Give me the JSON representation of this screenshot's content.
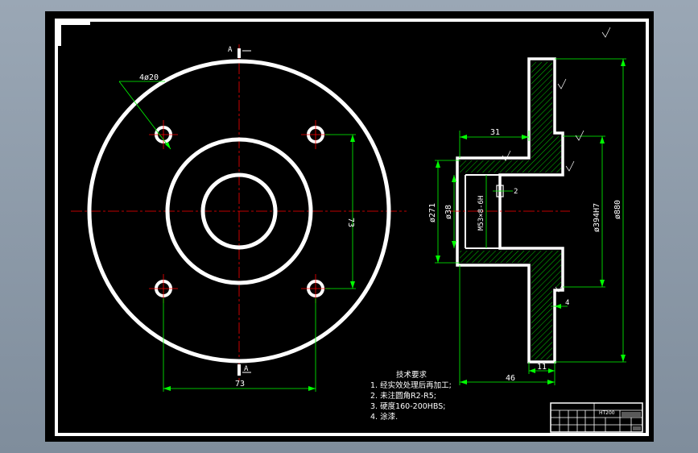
{
  "colors": {
    "viewport_bg": "#8d9aa8",
    "sheet_bg": "#000000",
    "outline": "#ffffff",
    "dimension": "#00ff00",
    "centerline": "#ff0000",
    "hatch": "#00ff00"
  },
  "front_view": {
    "section_label_top": "A",
    "section_label_bottom": "A",
    "hole_callout": "4ø20",
    "dim_vertical": "73",
    "dim_horizontal": "73"
  },
  "side_view": {
    "dim_top_width": "31",
    "dim_bottom_width": "46",
    "dim_flange_thickness": "11",
    "dim_groove": "2",
    "dim_small": "4",
    "dim_d271": "ø271",
    "dim_d38": "ø38",
    "dim_thread": "M53×8-6H",
    "dim_d394": "ø394H7",
    "dim_d880": "ø880"
  },
  "tech_requirements": {
    "title": "技术要求",
    "items": [
      "1. 经实效处理后再加工;",
      "2. 未注圆角R2-R5;",
      "3. 硬度160-200HBS;",
      "4. 涂漆."
    ]
  },
  "title_block": {
    "material": "HT200"
  }
}
